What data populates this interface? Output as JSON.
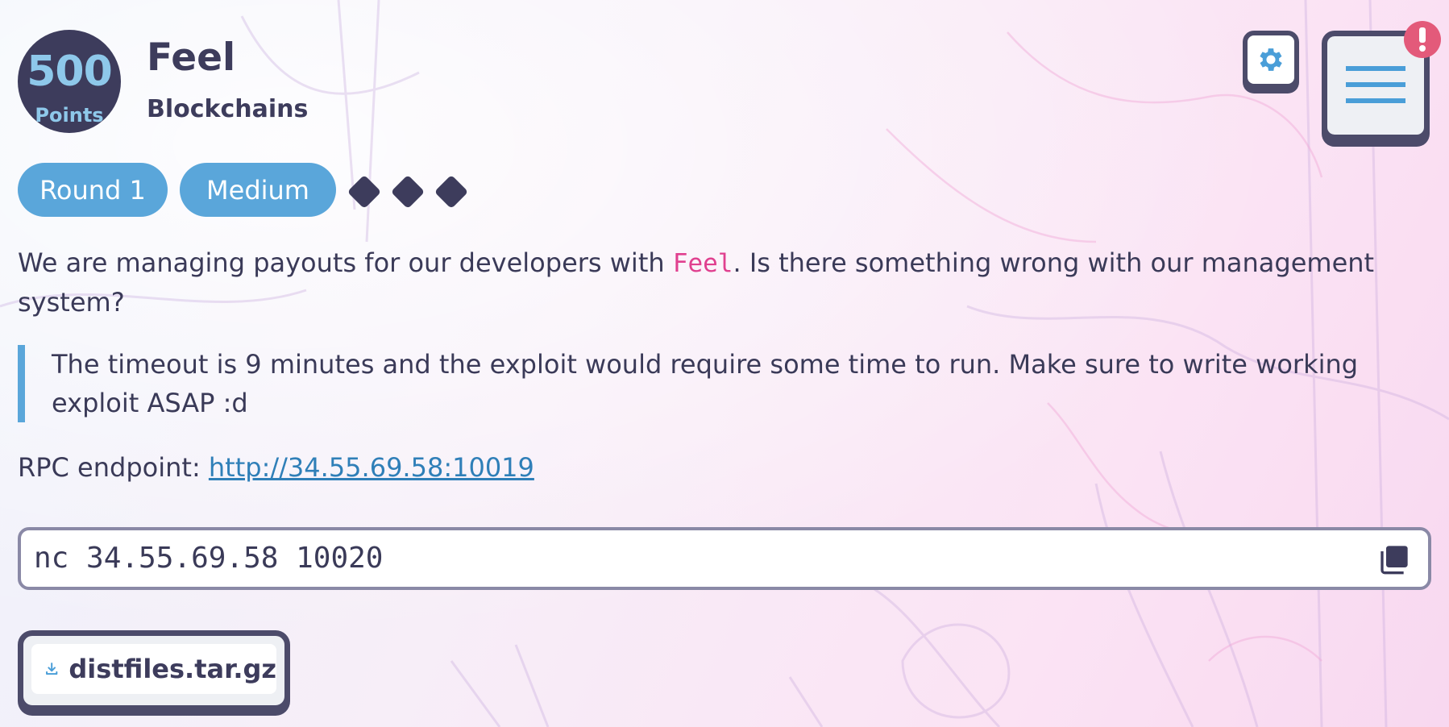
{
  "challenge": {
    "points_value": "500",
    "points_label": "Points",
    "title": "Feel",
    "category": "Blockchains"
  },
  "tags": {
    "round": "Round 1",
    "difficulty": "Medium",
    "difficulty_level": 3
  },
  "description": {
    "before": "We are managing payouts for our developers with ",
    "code": "Feel",
    "after": ". Is there something wrong with our management system?"
  },
  "note": "The timeout is 9 minutes and the exploit would require some time to run. Make sure to write working exploit ASAP :d",
  "rpc": {
    "label": "RPC endpoint: ",
    "url": "http://34.55.69.58:10019"
  },
  "command": "nc 34.55.69.58 10020",
  "download": {
    "filename": "distfiles.tar.gz"
  },
  "icons": {
    "settings": "gear-icon",
    "menu": "menu-icon",
    "alert": "exclamation-icon",
    "copy": "copy-icon",
    "download": "download-icon"
  },
  "colors": {
    "accent_blue": "#5aa6da",
    "dark_navy": "#3d3c5c",
    "code_pink": "#e0408f",
    "alert_red": "#e35a7a"
  }
}
